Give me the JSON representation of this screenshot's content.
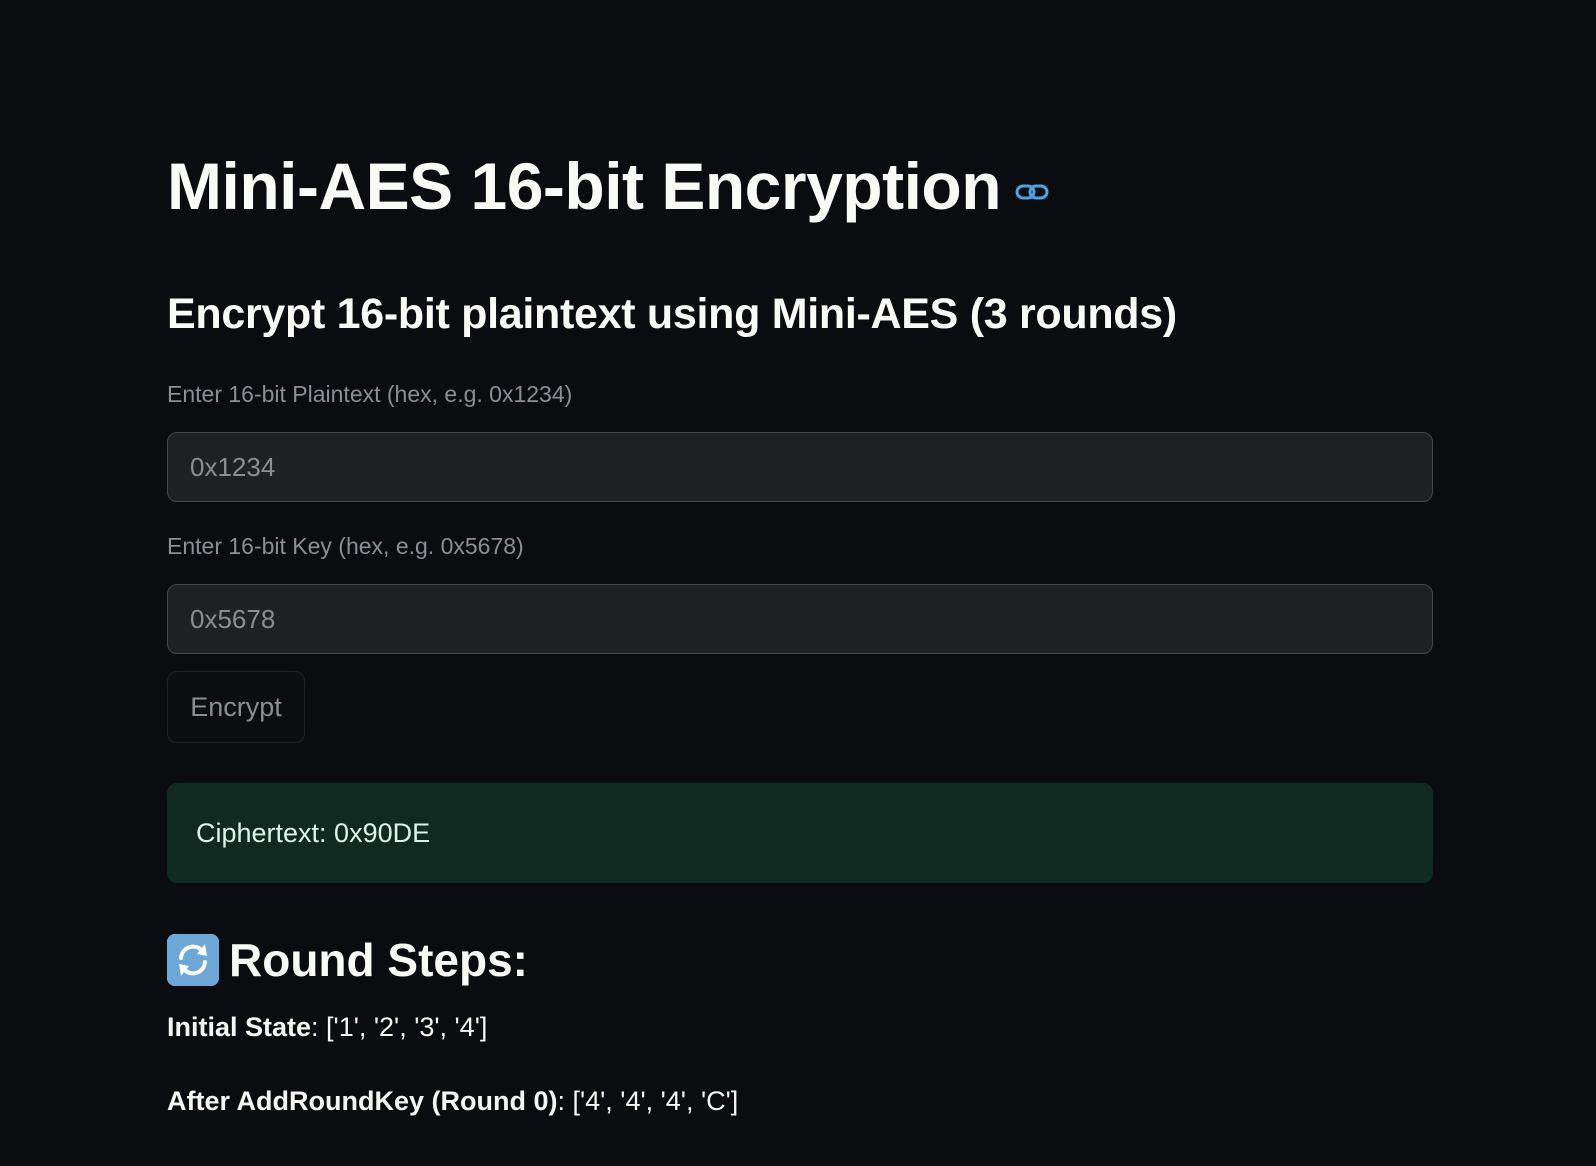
{
  "page": {
    "title": "Mini-AES 16-bit Encryption",
    "subtitle": "Encrypt 16-bit plaintext using Mini-AES (3 rounds)"
  },
  "form": {
    "plaintext_label": "Enter 16-bit Plaintext (hex, e.g. 0x1234)",
    "plaintext_placeholder": "0x1234",
    "plaintext_value": "",
    "key_label": "Enter 16-bit Key (hex, e.g. 0x5678)",
    "key_placeholder": "0x5678",
    "key_value": "",
    "encrypt_label": "Encrypt"
  },
  "result": {
    "ciphertext_text": "Ciphertext: 0x90DE"
  },
  "steps": {
    "icon": "refresh-icon",
    "heading": "Round Steps:",
    "items": [
      {
        "label": "Initial State",
        "value": ": ['1', '2', '3', '4']"
      },
      {
        "label": "After AddRoundKey (Round 0)",
        "value": ": ['4', '4', '4', 'C']"
      }
    ]
  },
  "colors": {
    "background": "#0a0c10",
    "accent_link": "#4fa3e0",
    "success_bg": "#0f2a21",
    "success_text": "#d9f7e8"
  }
}
